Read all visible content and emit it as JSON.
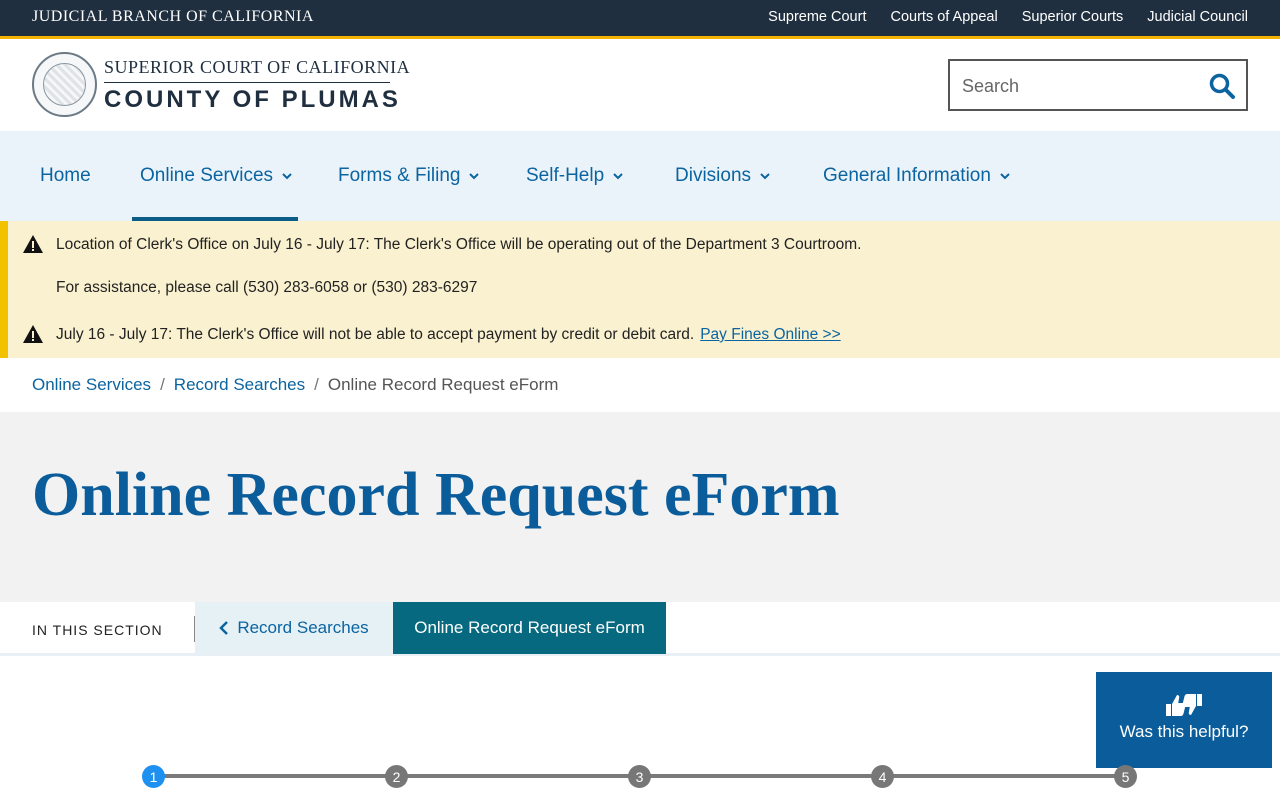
{
  "topbar": {
    "brand": "JUDICIAL BRANCH OF CALIFORNIA",
    "links": [
      "Supreme Court",
      "Courts of Appeal",
      "Superior Courts",
      "Judicial Council"
    ],
    "background": "#1f2f3f",
    "accent": "#f2b300"
  },
  "header": {
    "court_line": "SUPERIOR COURT OF CALIFORNIA",
    "county_line": "COUNTY OF PLUMAS",
    "logo_icon": "court-seal-icon",
    "search": {
      "placeholder": "Search",
      "value": "",
      "icon": "search-icon"
    }
  },
  "nav": {
    "items": [
      {
        "label": "Home",
        "dropdown": false
      },
      {
        "label": "Online Services",
        "dropdown": true,
        "active": true
      },
      {
        "label": "Forms & Filing",
        "dropdown": true
      },
      {
        "label": "Self-Help",
        "dropdown": true
      },
      {
        "label": "Divisions",
        "dropdown": true
      },
      {
        "label": "General Information",
        "dropdown": true
      }
    ],
    "active_color": "#0b5c87"
  },
  "alerts": [
    {
      "icon": "warning-icon",
      "bold": "Location of Clerk's Office on July 16 - July 17:",
      "text": " The Clerk's Office will be operating out of the Department 3 Courtroom."
    },
    {
      "icon": "",
      "bold": "",
      "text": "For assistance, please call (530) 283-6058 or (530) 283-6297"
    },
    {
      "icon": "warning-icon",
      "bold": "July 16 - July 17:",
      "text": " The Clerk's Office will not be able to accept payment by credit or debit card.",
      "link": "Pay Fines Online >>"
    }
  ],
  "breadcrumb": {
    "items": [
      "Online Services",
      "Record Searches",
      "Online Record Request eForm"
    ],
    "separator": "/"
  },
  "page": {
    "title": "Online Record Request eForm"
  },
  "section": {
    "label": "IN THIS SECTION",
    "back": "Record Searches",
    "current": "Online Record Request eForm"
  },
  "feedback": {
    "label": "Was this helpful?",
    "icon": "thumbs-up-down-icon"
  },
  "stepper": {
    "steps": [
      "1",
      "2",
      "3",
      "4",
      "5"
    ],
    "active_step": 1,
    "active_color": "#1e90f0"
  }
}
